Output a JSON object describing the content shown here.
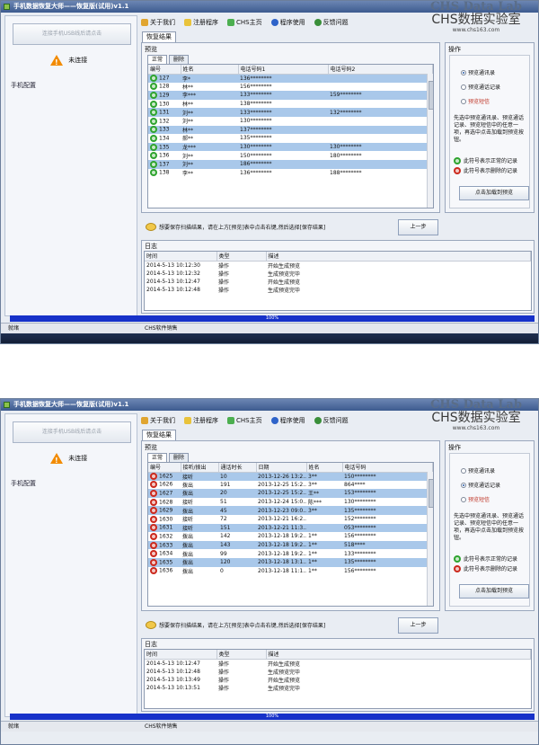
{
  "app": {
    "title": "手机数据恢复大师——恢复版(试用)v1.1",
    "watermark_title": "CHS Data Lab",
    "watermark_cn": "CHS数据实验室",
    "watermark_url": "www.chs163.com"
  },
  "left": {
    "usb_button": "连接手机USB线后请点击",
    "status": "未连接",
    "config_label": "手机配置"
  },
  "toolbar": [
    "关于我们",
    "注册程序",
    "CHS主页",
    "程序使用",
    "反馈问题"
  ],
  "tab_recover": "恢复结果",
  "preview": {
    "title": "预览",
    "subtab_normal": "正常",
    "subtab_deleted": "删除"
  },
  "op": {
    "title": "操作",
    "radio1": "预览通讯录",
    "radio2": "预览通话记录",
    "radio3": "预览短信",
    "tip": "先选中预览通讯录、预览通话记录、预览短信中的任意一项，再选中点击加载到预览按钮。",
    "legend_ok": "此符号表示正常的记录",
    "legend_del": "此符号表示删除的记录",
    "load_button": "点击加载到预览"
  },
  "hint": "想要保存扫描结果，请在上方[预览]表中点击右键,然后选择[保存结果]",
  "prev_button": "上一步",
  "log": {
    "title": "日志",
    "cols": [
      "时间",
      "类型",
      "描述"
    ]
  },
  "progress": "100%",
  "status": {
    "ready": "就绪",
    "sales": "CHS软件销售"
  },
  "shot1": {
    "cols": [
      "编号",
      "姓名",
      "电话号码1",
      "电话号码2"
    ],
    "rows": [
      {
        "status": "ok",
        "cells": [
          "127",
          "李*",
          "136********",
          ""
        ]
      },
      {
        "status": "ok",
        "cells": [
          "128",
          "林**",
          "156********",
          ""
        ]
      },
      {
        "status": "ok",
        "cells": [
          "129",
          "李***",
          "133********",
          "159********"
        ]
      },
      {
        "status": "ok",
        "cells": [
          "130",
          "林**",
          "138********",
          ""
        ]
      },
      {
        "status": "ok",
        "cells": [
          "131",
          "刘**",
          "133********",
          "132********"
        ]
      },
      {
        "status": "ok",
        "cells": [
          "132",
          "刘**",
          "130********",
          ""
        ]
      },
      {
        "status": "ok",
        "cells": [
          "133",
          "林**",
          "137********",
          ""
        ]
      },
      {
        "status": "ok",
        "cells": [
          "134",
          "郝**",
          "135********",
          ""
        ]
      },
      {
        "status": "ok",
        "cells": [
          "135",
          "龙***",
          "130********",
          "130********"
        ]
      },
      {
        "status": "ok",
        "cells": [
          "136",
          "刘**",
          "150********",
          "180********"
        ]
      },
      {
        "status": "ok",
        "cells": [
          "137",
          "刘**",
          "186********",
          ""
        ]
      },
      {
        "status": "ok",
        "cells": [
          "138",
          "李**",
          "136********",
          "188********"
        ]
      }
    ],
    "radio_selected": 1,
    "log_rows": [
      [
        "2014-5-13 10:12:30",
        "操作",
        "开始生成预览"
      ],
      [
        "2014-5-13 10:12:32",
        "操作",
        "生成预览完毕"
      ],
      [
        "2014-5-13 10:12:47",
        "操作",
        "开始生成预览"
      ],
      [
        "2014-5-13 10:12:48",
        "操作",
        "生成预览完毕"
      ]
    ]
  },
  "shot2": {
    "cols": [
      "编号",
      "接听/拨出",
      "通话时长",
      "日期",
      "姓名",
      "电话号码"
    ],
    "rows": [
      {
        "status": "del",
        "cells": [
          "1625",
          "接听",
          "10",
          "2013-12-26 13:2...",
          "3**",
          "150********"
        ]
      },
      {
        "status": "del",
        "cells": [
          "1626",
          "拨出",
          "191",
          "2013-12-25 15:2...",
          "3**",
          "864****"
        ]
      },
      {
        "status": "del",
        "cells": [
          "1627",
          "拨出",
          "20",
          "2013-12-25 15:2...",
          "王**",
          "153********"
        ]
      },
      {
        "status": "del",
        "cells": [
          "1628",
          "接听",
          "51",
          "2013-12-24 15:0...",
          "陈***",
          "130********"
        ]
      },
      {
        "status": "del",
        "cells": [
          "1629",
          "拨出",
          "45",
          "2013-12-23 09:0...",
          "3**",
          "135********"
        ]
      },
      {
        "status": "del",
        "cells": [
          "1630",
          "接听",
          "72",
          "2013-12-21 16:2...",
          "",
          "152********"
        ]
      },
      {
        "status": "del",
        "cells": [
          "1631",
          "接听",
          "151",
          "2013-12-21 11:3...",
          "",
          "053********"
        ]
      },
      {
        "status": "del",
        "cells": [
          "1632",
          "拨出",
          "142",
          "2013-12-18 19:2...",
          "1**",
          "156********"
        ]
      },
      {
        "status": "del",
        "cells": [
          "1633",
          "拨出",
          "143",
          "2013-12-18 19:2...",
          "1**",
          "518****"
        ]
      },
      {
        "status": "del",
        "cells": [
          "1634",
          "拨出",
          "99",
          "2013-12-18 19:2...",
          "1**",
          "133********"
        ]
      },
      {
        "status": "del",
        "cells": [
          "1635",
          "拨出",
          "120",
          "2013-12-18 13:1...",
          "1**",
          "135********"
        ]
      },
      {
        "status": "del",
        "cells": [
          "1636",
          "拨出",
          "0",
          "2013-12-18 11:1...",
          "1**",
          "156********"
        ]
      }
    ],
    "radio_selected": 2,
    "log_rows": [
      [
        "2014-5-13 10:12:47",
        "操作",
        "开始生成预览"
      ],
      [
        "2014-5-13 10:12:48",
        "操作",
        "生成预览完毕"
      ],
      [
        "2014-5-13 10:13:49",
        "操作",
        "开始生成预览"
      ],
      [
        "2014-5-13 10:13:51",
        "操作",
        "生成预览完毕"
      ]
    ]
  },
  "colors": {
    "ok": "#2fa42f",
    "del": "#cc2a1e",
    "row_highlight": "#a9c8ea",
    "progress": "#1732c9"
  }
}
